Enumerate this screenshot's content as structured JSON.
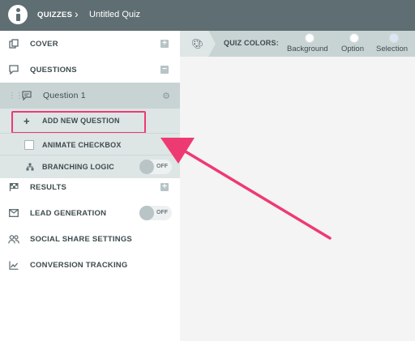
{
  "header": {
    "crumb_root": "QUIZZES",
    "crumb_sep": "›",
    "crumb_current": "Untitled Quiz"
  },
  "sidebar": {
    "cover": "COVER",
    "questions": "QUESTIONS",
    "question1": "Question 1",
    "add_question": "ADD NEW QUESTION",
    "animate_checkbox": "ANIMATE CHECKBOX",
    "branching_logic": "BRANCHING LOGIC",
    "results": "RESULTS",
    "lead_generation": "LEAD GENERATION",
    "social_share": "SOCIAL SHARE SETTINGS",
    "conversion_tracking": "CONVERSION TRACKING",
    "toggle_off": "OFF"
  },
  "toolbar": {
    "quiz_colors": "QUIZ COLORS:",
    "background": "Background",
    "option": "Option",
    "selection": "Selection"
  },
  "colors": {
    "topbar": "#5f6e72",
    "highlight": "#ee3a73",
    "selection_swatch": "#dbe5f3"
  }
}
